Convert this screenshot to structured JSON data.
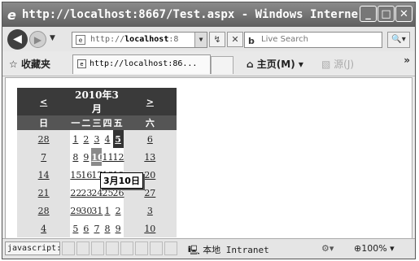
{
  "window": {
    "ie_icon": "ie-logo-icon",
    "title": "http://localhost:8667/Test.aspx - Windows Interne...",
    "min": "_",
    "max": "□",
    "close": "✕"
  },
  "nav": {
    "back": "◀",
    "forward": "▶",
    "dropdown": "▼",
    "address_prefix": "http://",
    "address_host": "localhost",
    "address_suffix": ":8",
    "refresh": "↯",
    "stop": "✕",
    "search_placeholder": "Live Search",
    "search_logo": "b",
    "search_button": "🔍▾"
  },
  "favorites": {
    "label": "收藏夹",
    "tab_title": "http://localhost:86...",
    "home_label": "主页(M)",
    "feeds": "源(J)",
    "more": "»"
  },
  "calendar": {
    "prev": "<",
    "next": ">",
    "month": "2010年3月",
    "days_of_week": [
      "日",
      "一",
      "二",
      "三",
      "四",
      "五",
      "六"
    ],
    "weeks": [
      [
        "28",
        "1",
        "2",
        "3",
        "4",
        "5",
        "6"
      ],
      [
        "7",
        "8",
        "9",
        "10",
        "11",
        "12",
        "13"
      ],
      [
        "14",
        "15",
        "16",
        "17",
        "18",
        "19",
        "20"
      ],
      [
        "21",
        "22",
        "23",
        "24",
        "25",
        "26",
        "27"
      ],
      [
        "28",
        "29",
        "30",
        "31",
        "1",
        "2",
        "3"
      ],
      [
        "4",
        "5",
        "6",
        "7",
        "8",
        "9",
        "10"
      ]
    ],
    "selected_day": "10",
    "today_day": "5"
  },
  "tooltip": "3月10日",
  "status": {
    "text": "javascript:",
    "zone": "本地 Intranet",
    "zoom": "100%"
  }
}
